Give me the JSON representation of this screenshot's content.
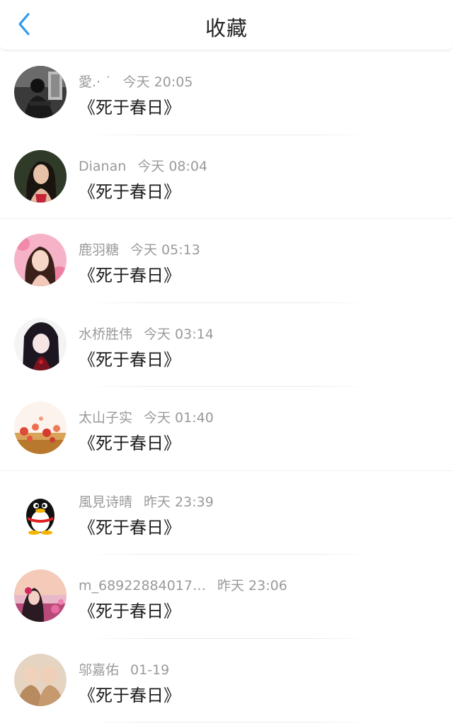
{
  "header": {
    "title": "收藏",
    "back_icon": "chevron-left-icon",
    "accent_color": "#2f9af2"
  },
  "items": [
    {
      "name": "愛.· ˙",
      "time": "今天 20:05",
      "content": "《死于春日》",
      "avatar_icon": "avatar-dark-room-icon"
    },
    {
      "name": "Dianan",
      "time": "今天 08:04",
      "content": "《死于春日》",
      "avatar_icon": "avatar-portrait-woman-icon"
    },
    {
      "name": "鹿羽糖",
      "time": "今天 05:13",
      "content": "《死于春日》",
      "avatar_icon": "avatar-pink-portrait-icon"
    },
    {
      "name": "水桥胜伟",
      "time": "今天 03:14",
      "content": "《死于春日》",
      "avatar_icon": "avatar-anime-girl-icon"
    },
    {
      "name": "太山子实",
      "time": "今天 01:40",
      "content": "《死于春日》",
      "avatar_icon": "avatar-flowers-icon"
    },
    {
      "name": "風見诗晴",
      "time": "昨天 23:39",
      "content": "《死于春日》",
      "avatar_icon": "avatar-penguin-icon"
    },
    {
      "name": "m_68922884017…",
      "time": "昨天 23:06",
      "content": "《死于春日》",
      "avatar_icon": "avatar-sunset-girl-icon"
    },
    {
      "name": "邬嘉佑",
      "time": "01-19",
      "content": "《死于春日》",
      "avatar_icon": "avatar-two-people-icon"
    }
  ]
}
